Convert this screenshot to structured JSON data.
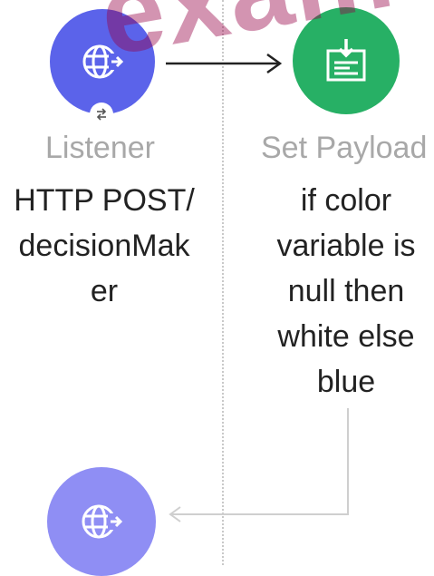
{
  "watermark": "exam",
  "flow": {
    "listener": {
      "type_label": "Listener",
      "description_lines": [
        "HTTP POST/",
        "decisionMak",
        "er"
      ],
      "icon": "globe-arrow-icon",
      "color": "#5b63ea"
    },
    "set_payload": {
      "type_label": "Set Payload",
      "description_lines": [
        "if color",
        "variable is",
        "null then",
        "white else",
        "blue"
      ],
      "icon": "payload-download-icon",
      "color": "#27b065"
    },
    "response": {
      "icon": "globe-arrow-icon",
      "color": "#8f8ef4"
    },
    "reconnect_icon": "reconnect-arrows-icon"
  }
}
